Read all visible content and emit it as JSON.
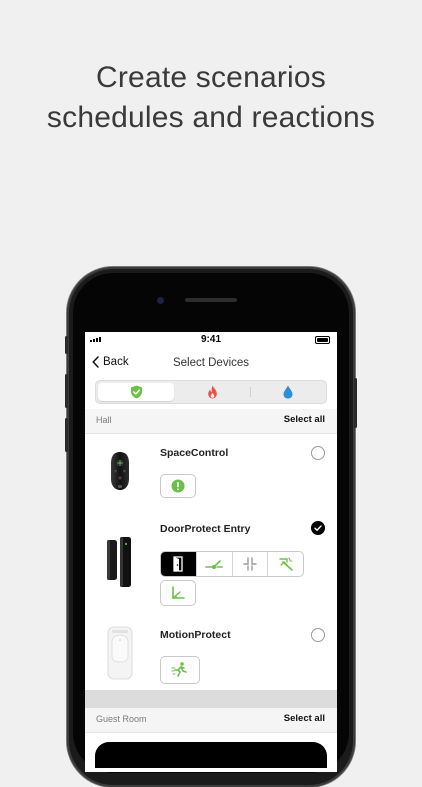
{
  "headline": {
    "line1": "Create scenarios",
    "line2": "schedules and reactions"
  },
  "status_bar": {
    "time": "9:41"
  },
  "nav": {
    "back_label": "Back",
    "title": "Select Devices"
  },
  "tabs": [
    {
      "icon": "shield-check-icon",
      "active": true,
      "color": "#6cc04a"
    },
    {
      "icon": "flame-icon",
      "active": false,
      "color": "#e8534a"
    },
    {
      "icon": "water-drop-icon",
      "active": false,
      "color": "#2c8fd6"
    }
  ],
  "groups": [
    {
      "name": "Hall",
      "select_all": "Select all",
      "devices": [
        {
          "name": "SpaceControl",
          "selected": false,
          "actions": [
            "alarm-icon"
          ]
        },
        {
          "name": "DoorProtect Entry",
          "selected": true,
          "actions": [
            "door-open-icon",
            "opening-sensor-icon",
            "magnet-icon",
            "tamper-icon",
            "tilt-icon"
          ]
        },
        {
          "name": "MotionProtect",
          "selected": false,
          "actions": [
            "running-man-icon"
          ]
        }
      ]
    },
    {
      "name": "Guest Room",
      "select_all": "Select all"
    }
  ],
  "colors": {
    "accent": "#6cc04a",
    "text_dark": "#222222",
    "background": "#f0f0f0"
  }
}
